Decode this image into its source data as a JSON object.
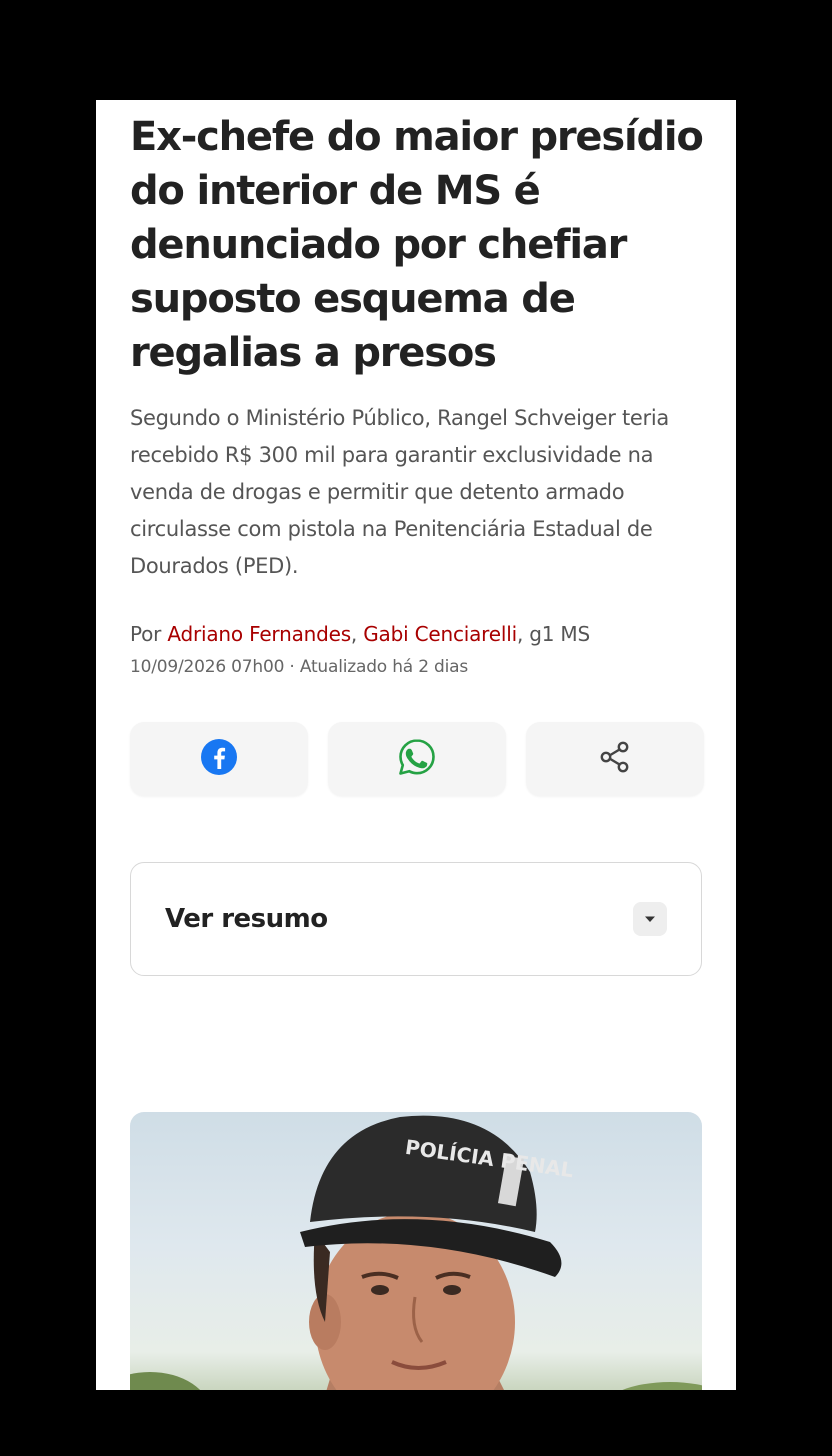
{
  "article": {
    "headline": "Ex-chefe do maior presídio do interior de MS é denunciado por chefiar suposto esquema de regalias a presos",
    "subtitle": "Segundo o Ministério Público, Rangel Schveiger teria recebido R$ 300 mil para garantir exclusividade na venda de drogas e permitir que detento armado circulasse com pistola na Penitenciária Estadual de Dourados (PED).",
    "byline": {
      "prefix": "Por ",
      "authors": [
        "Adriano Fernandes",
        "Gabi Cenciarelli"
      ],
      "separator": ", ",
      "outlet": ", g1 MS"
    },
    "dateline": "10/09/2026 07h00 · Atualizado há 2 dias"
  },
  "share": {
    "buttons": [
      {
        "icon": "facebook-icon",
        "color": "#1877f2"
      },
      {
        "icon": "whatsapp-icon",
        "color": "#25a244"
      },
      {
        "icon": "share-icon",
        "color": "#444444"
      }
    ]
  },
  "summary": {
    "label": "Ver resumo",
    "toggle_icon": "caret-down-icon"
  },
  "photo": {
    "cap_text": "POLÍCIA PENAL"
  },
  "colors": {
    "author_link": "#a80000",
    "headline": "#222222",
    "body_text": "#555555",
    "background": "#ffffff",
    "outer": "#000000"
  }
}
